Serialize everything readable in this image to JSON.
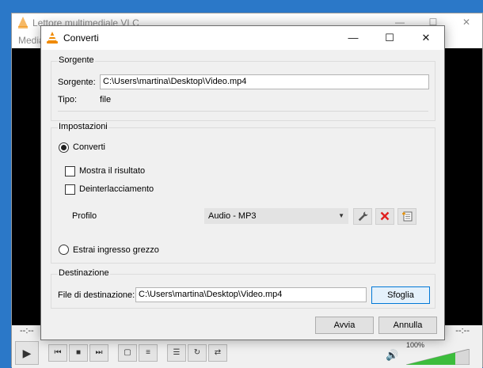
{
  "background_window": {
    "title": "Lettore multimediale VLC",
    "menu_partial": "Media",
    "time_elapsed": "--:--",
    "time_total": "--:--",
    "volume_percent": "100%"
  },
  "dialog": {
    "title": "Converti",
    "source_group": {
      "title": "Sorgente",
      "source_label": "Sorgente:",
      "source_value": "C:\\Users\\martina\\Desktop\\Video.mp4",
      "type_label": "Tipo:",
      "type_value": "file"
    },
    "settings_group": {
      "title": "Impostazioni",
      "convert_label": "Converti",
      "show_result_label": "Mostra il risultato",
      "deinterlace_label": "Deinterlacciamento",
      "profile_label": "Profilo",
      "profile_value": "Audio - MP3",
      "raw_input_label": "Estrai ingresso grezzo"
    },
    "destination_group": {
      "title": "Destinazione",
      "file_label": "File di destinazione:",
      "file_value": "C:\\Users\\martina\\Desktop\\Video.mp4",
      "browse_label": "Sfoglia"
    },
    "start_label": "Avvia",
    "cancel_label": "Annulla"
  },
  "colors": {
    "desktop": "#2b78c8",
    "vlc_orange": "#f08a00",
    "delete_red": "#e02020",
    "focus_blue": "#0078d7"
  }
}
